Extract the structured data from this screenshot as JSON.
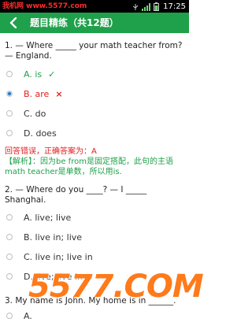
{
  "status_bar": {
    "site": "我机网 www.5577.com",
    "time": "17:25"
  },
  "header": {
    "title": "题目精练（共12题）",
    "back_icon": "chevron-left-icon"
  },
  "question1": {
    "text": "1. — Where _____ your math teacher from? — England.",
    "options": [
      {
        "label": "A. is",
        "mark": "✓",
        "state": "correct"
      },
      {
        "label": "B. are",
        "mark": "×",
        "state": "wrong-selected"
      },
      {
        "label": "C. do",
        "state": "normal"
      },
      {
        "label": "D. does",
        "state": "normal"
      }
    ],
    "answer_result": "回答错误，正确答案为：A",
    "analysis": "【解析】：因为be from是固定搭配，此句的主语math teacher是单数，所以用is."
  },
  "question2": {
    "text": "2.  — Where do you ____? — I _____ Shanghai.",
    "options": [
      {
        "label": "A. live; live"
      },
      {
        "label": "B. live in; live"
      },
      {
        "label": "C. live in; live in"
      },
      {
        "label": "D. live; live in"
      }
    ]
  },
  "question3": {
    "text": "3.  My name is John. My home is in ______.",
    "option_partial": "A."
  },
  "watermark": "5577.COM",
  "colors": {
    "accent": "#1fa04a",
    "error": "#e02020",
    "status_bar": "#000000",
    "radio_selected": "#1a7ad0"
  }
}
